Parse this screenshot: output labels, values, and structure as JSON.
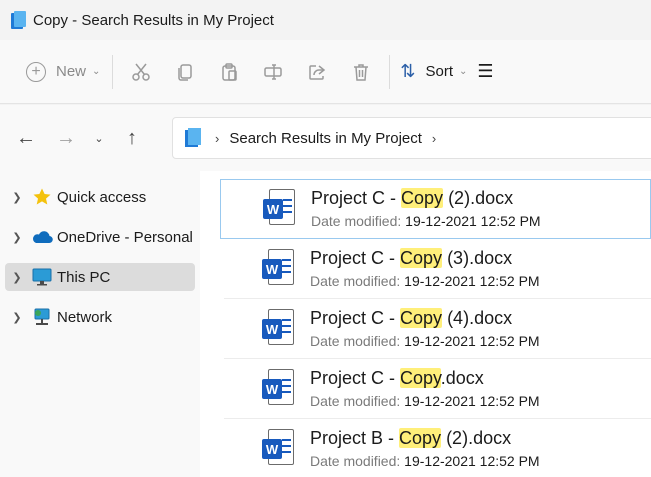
{
  "window": {
    "title": "Copy - Search Results in My Project"
  },
  "toolbar": {
    "new_label": "New",
    "new_icon": "plus-circle-icon",
    "sort_label": "Sort",
    "buttons": [
      "cut-icon",
      "copy-icon",
      "paste-icon",
      "rename-icon",
      "share-icon",
      "delete-icon"
    ]
  },
  "navigation": {
    "back_icon": "arrow-left-icon",
    "forward_icon": "arrow-right-icon",
    "recent_icon": "chevron-down-icon",
    "up_icon": "arrow-up-icon",
    "address": {
      "icon": "search-results-folder-icon",
      "location": "Search Results in My Project"
    }
  },
  "sidebar": {
    "items": [
      {
        "label": "Quick access",
        "icon": "star-icon"
      },
      {
        "label": "OneDrive - Personal",
        "icon": "cloud-icon"
      },
      {
        "label": "This PC",
        "icon": "monitor-icon",
        "selected": true
      },
      {
        "label": "Network",
        "icon": "network-icon"
      }
    ]
  },
  "results": {
    "meta_label": "Date modified:",
    "files": [
      {
        "name_before": "Project C - ",
        "name_match": "Copy",
        "name_after": " (2).docx",
        "date": "19-12-2021 12:52 PM",
        "selected": true
      },
      {
        "name_before": "Project C - ",
        "name_match": "Copy",
        "name_after": " (3).docx",
        "date": "19-12-2021 12:52 PM"
      },
      {
        "name_before": "Project C - ",
        "name_match": "Copy",
        "name_after": " (4).docx",
        "date": "19-12-2021 12:52 PM"
      },
      {
        "name_before": "Project C - ",
        "name_match": "Copy",
        "name_after": ".docx",
        "date": "19-12-2021 12:52 PM"
      },
      {
        "name_before": "Project B - ",
        "name_match": "Copy",
        "name_after": " (2).docx",
        "date": "19-12-2021 12:52 PM"
      }
    ]
  },
  "colors": {
    "highlight": "#ffef7a",
    "word_blue": "#185abd",
    "selection_border": "#99c9ef"
  }
}
